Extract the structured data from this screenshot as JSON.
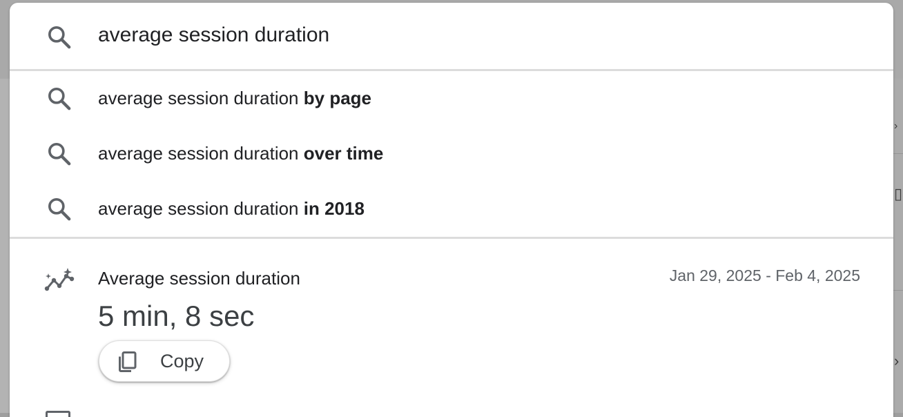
{
  "search": {
    "query": "average session duration"
  },
  "suggestions": [
    {
      "base": "average session duration ",
      "bold": "by page"
    },
    {
      "base": "average session duration ",
      "bold": "over time"
    },
    {
      "base": "average session duration ",
      "bold": "in 2018"
    }
  ],
  "result": {
    "title": "Average session duration",
    "date_range": "Jan 29, 2025 - Feb 4, 2025",
    "value": "5 min, 8 sec",
    "copy_label": "Copy"
  },
  "icons": {
    "search": "search-icon",
    "insight": "insights-icon",
    "copy": "copy-icon"
  },
  "colors": {
    "icon_gray": "#5f6368",
    "text": "#202124",
    "secondary_text": "#5f6368"
  }
}
